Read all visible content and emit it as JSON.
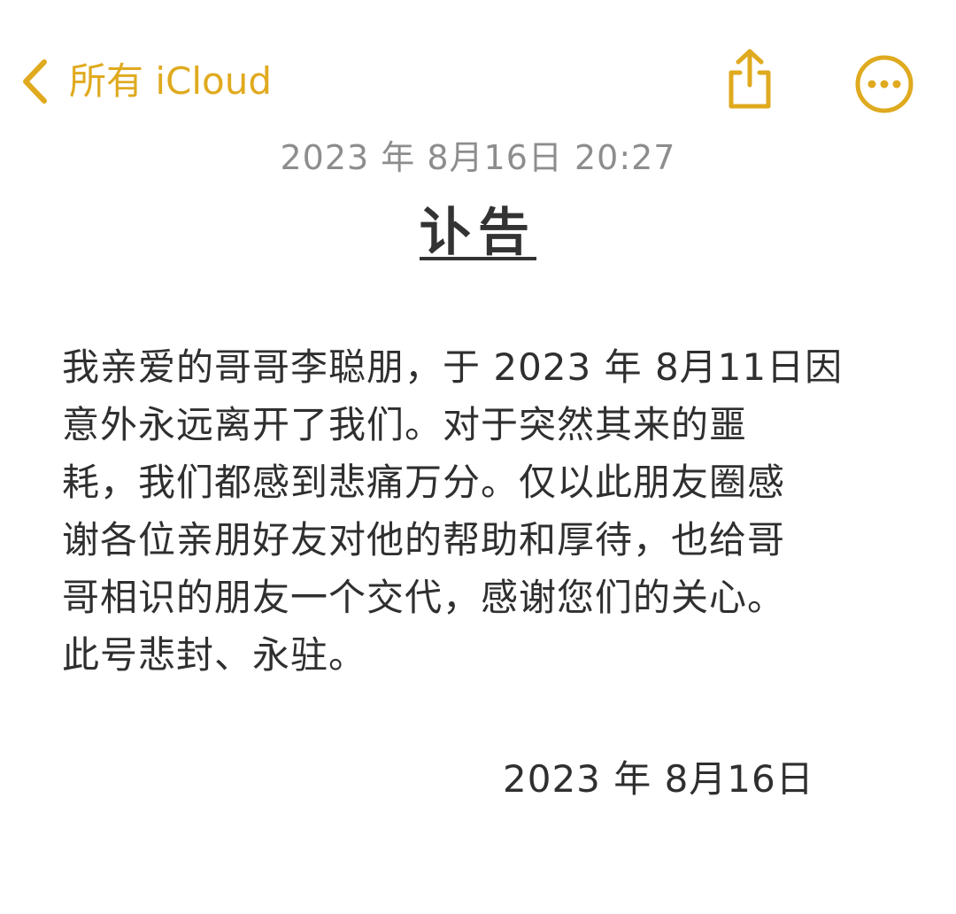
{
  "nav": {
    "back_label": "所有 iCloud",
    "back_icon": "chevron-left-icon",
    "share_icon": "share-icon",
    "more_icon": "ellipsis-circle-icon",
    "accent_color": "#e0aa1f"
  },
  "note": {
    "timestamp": "2023 年 8月16日 20:27",
    "title": "讣告",
    "lines": [
      "我亲爱的哥哥李聪朋，于 2023 年 8月11日因",
      "意外永远离开了我们。对于突然其来的噩",
      "耗，我们都感到悲痛万分。仅以此朋友圈感",
      "谢各位亲朋好友对他的帮助和厚待，也给哥",
      "哥相识的朋友一个交代，感谢您们的关心。",
      "此号悲封、永驻。"
    ],
    "signature_date": "2023 年 8月16日"
  }
}
